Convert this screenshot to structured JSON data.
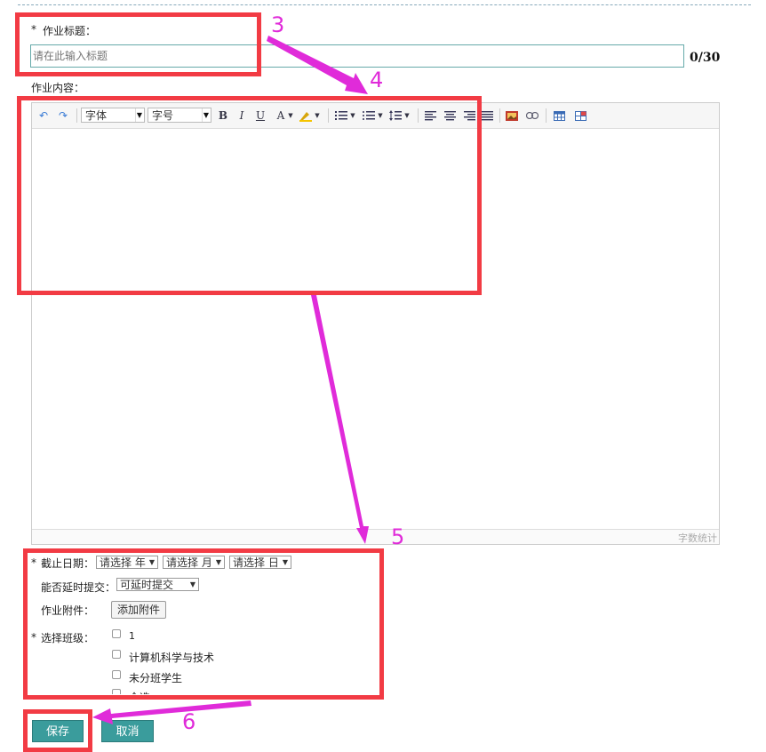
{
  "form": {
    "title_label": "作业标题：",
    "required_mark": "*",
    "title_placeholder": "请在此输入标题",
    "title_counter": "0/30",
    "content_label": "作业内容：",
    "deadline_label": "截止日期：",
    "year_select": "请选择 年",
    "month_select": "请选择 月",
    "day_select": "请选择 日",
    "late_label": "能否延时提交：",
    "late_select": "可延时提交",
    "attach_label": "作业附件：",
    "attach_button": "添加附件",
    "class_label": "选择班级：",
    "classes": [
      "1",
      "计算机科学与技术",
      "未分班学生",
      "全选"
    ],
    "save_button": "保存",
    "cancel_button": "取消"
  },
  "editor": {
    "font_select": "字体",
    "size_select": "字号",
    "bold": "B",
    "italic": "I",
    "underline": "U",
    "font_color": "A",
    "word_count": "字数统计"
  },
  "annotations": {
    "labels": [
      "3",
      "4",
      "5",
      "6"
    ],
    "box_color": "#f23b44",
    "arrow_color": "#e02bd9"
  }
}
